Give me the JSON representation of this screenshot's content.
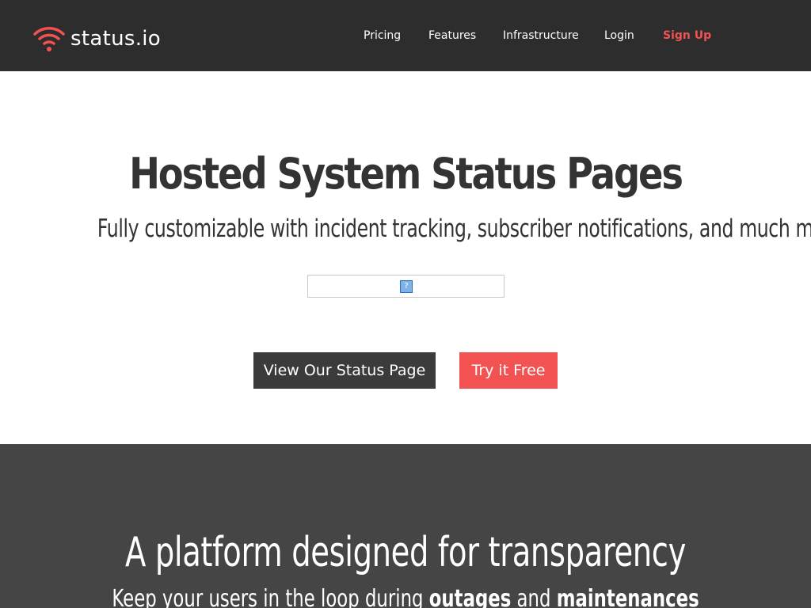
{
  "brand": {
    "name": "status.io",
    "accent_color": "#f25252",
    "header_bg": "#2d2d2d",
    "logo_icon": "wifi-signal-icon"
  },
  "nav": {
    "items": [
      {
        "label": "Pricing"
      },
      {
        "label": "Features"
      },
      {
        "label": "Infrastructure"
      },
      {
        "label": "Login"
      },
      {
        "label": "Sign Up"
      }
    ]
  },
  "hero": {
    "title": "Hosted System Status Pages",
    "subtitle": "Fully customizable with incident tracking, subscriber notifications, and much more",
    "broken_image_icon": "broken-image-icon",
    "broken_image_glyph": "?",
    "buttons": {
      "view_status": "View Our Status Page",
      "try_free": "Try it Free"
    }
  },
  "platform": {
    "title": "A platform designed for transparency",
    "subtitle_start": "Keep your users in the loop during ",
    "subtitle_bold1": "outages",
    "subtitle_middle": " and ",
    "subtitle_bold2": "maintenances",
    "bg_color": "#454545"
  }
}
